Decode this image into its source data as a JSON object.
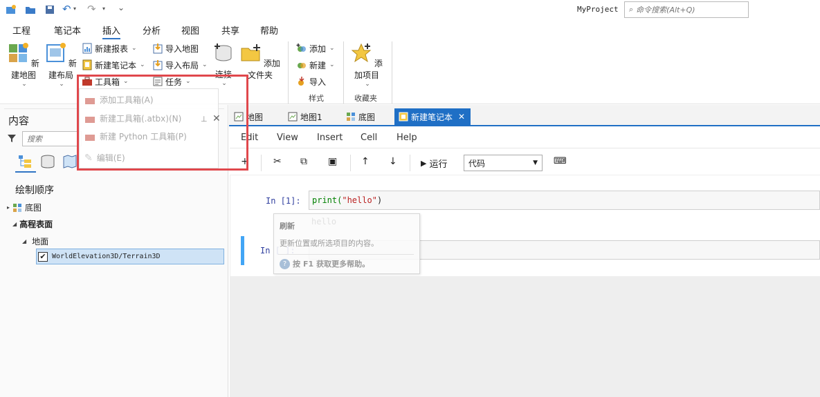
{
  "window": {
    "project_name": "MyProject",
    "search_placeholder": "命令搜索(Alt+Q)"
  },
  "ribbon_tabs": [
    "工程",
    "笔记本",
    "插入",
    "分析",
    "视图",
    "共享",
    "帮助"
  ],
  "ribbon": {
    "new_map": "新建地图",
    "new_layout": "新建布局",
    "new_report": "新建报表",
    "new_notebook": "新建笔记本",
    "toolbox": "工具箱",
    "import_map": "导入地图",
    "import_layout": "导入布局",
    "task": "任务",
    "connect": "连接",
    "add_folder": "添加文件夹",
    "add": "添加",
    "new": "新建",
    "import": "导入",
    "style_group": "样式",
    "add_item": "添加项目",
    "favorites_group": "收藏夹"
  },
  "toolbox_menu": {
    "add_toolbox": "添加工具箱(A)",
    "new_atbx": "新建工具箱(.atbx)(N)",
    "new_python": "新建 Python 工具箱(P)",
    "extra": "编辑(E)"
  },
  "contents_pane": {
    "title": "内容",
    "search_placeholder": "搜索",
    "drawing_order": "绘制顺序",
    "layers": {
      "basemap": "底图",
      "elevation_surfaces": "高程表面",
      "ground": "地面",
      "terrain": "WorldElevation3D/Terrain3D"
    }
  },
  "doc_tabs": [
    "地图",
    "地图1",
    "底图",
    "新建笔记本"
  ],
  "jupyter": {
    "menu": [
      "Edit",
      "View",
      "Insert",
      "Cell",
      "Help"
    ],
    "run_label": "运行",
    "cell_type": "代码",
    "cell1_prompt": "In  [1]:",
    "cell1_code_fn": "print(",
    "cell1_code_str": "\"hello\"",
    "cell1_code_end": ")",
    "cell1_output": "hello",
    "cell2_prompt": "In  [  ]:"
  },
  "tooltip": {
    "title": "刷新",
    "body": "更新位置或所选项目的内容。",
    "help_prefix": "按 ",
    "help_key": "F1",
    "help_suffix": " 获取更多帮助。"
  },
  "colors": {
    "accent": "#2f74c4",
    "highlight_box": "#e0474c",
    "active_tab": "#1f6fc5"
  }
}
